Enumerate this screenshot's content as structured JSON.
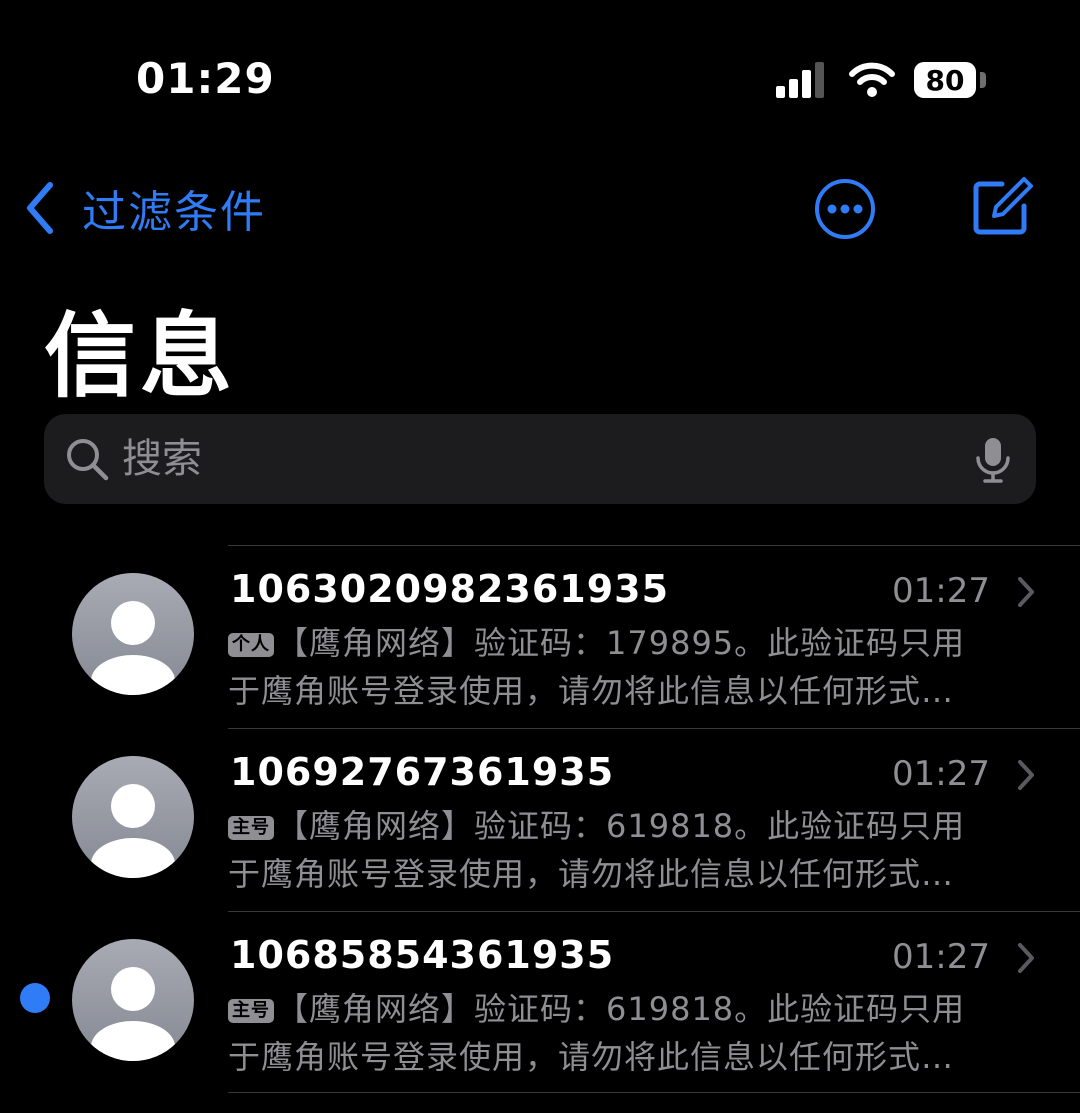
{
  "status_bar": {
    "time": "01:29",
    "battery": "80"
  },
  "nav": {
    "back_label": "过滤条件"
  },
  "page_title": "信息",
  "search": {
    "placeholder": "搜索"
  },
  "conversations": [
    {
      "sender": "1063020982361935",
      "time": "01:27",
      "tag": "个人",
      "preview_line1": "【鹰角网络】验证码：179895。此验证码只用",
      "preview_line2": "于鹰角账号登录使用，请勿将此信息以任何形式…",
      "unread": false
    },
    {
      "sender": "10692767361935",
      "time": "01:27",
      "tag": "主号",
      "preview_line1": "【鹰角网络】验证码：619818。此验证码只用",
      "preview_line2": "于鹰角账号登录使用，请勿将此信息以任何形式…",
      "unread": false
    },
    {
      "sender": "10685854361935",
      "time": "01:27",
      "tag": "主号",
      "preview_line1": "【鹰角网络】验证码：619818。此验证码只用",
      "preview_line2": "于鹰角账号登录使用，请勿将此信息以任何形式…",
      "unread": true
    }
  ],
  "colors": {
    "accent": "#2f7cf6",
    "background": "#000000",
    "secondary_text": "#8e8e93"
  }
}
